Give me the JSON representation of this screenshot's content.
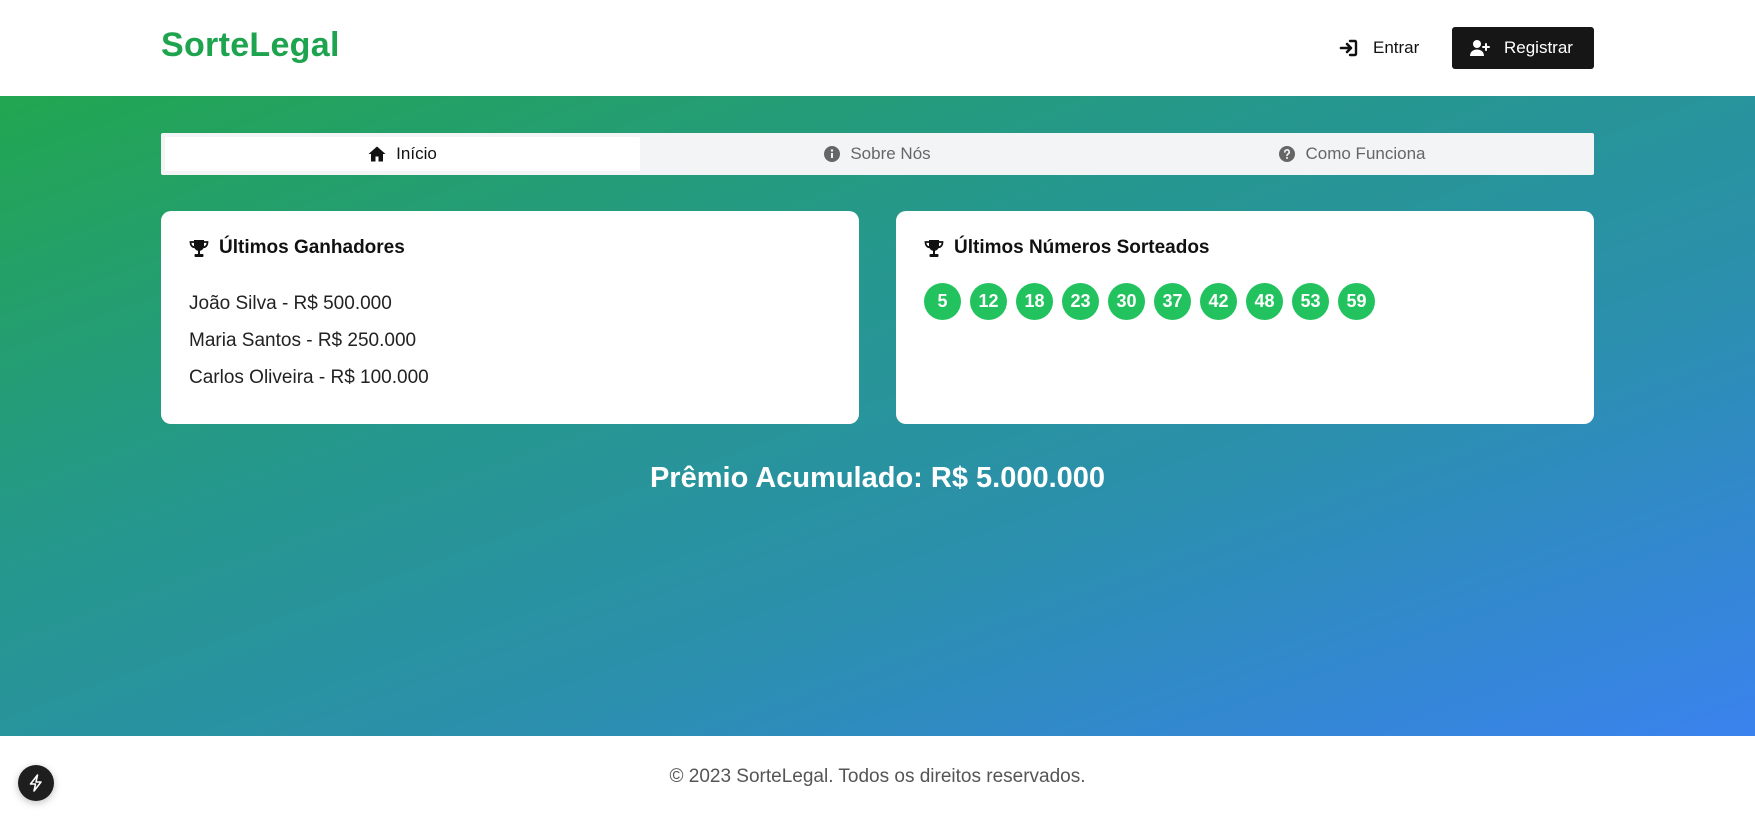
{
  "header": {
    "logo": "SorteLegal",
    "login_label": "Entrar",
    "register_label": "Registrar"
  },
  "tabs": [
    {
      "label": "Início",
      "icon": "home-icon",
      "active": true
    },
    {
      "label": "Sobre Nós",
      "icon": "info-icon",
      "active": false
    },
    {
      "label": "Como Funciona",
      "icon": "question-icon",
      "active": false
    }
  ],
  "winners_card": {
    "title": "Últimos Ganhadores",
    "icon": "trophy-icon",
    "items": [
      "João Silva - R$ 500.000",
      "Maria Santos - R$ 250.000",
      "Carlos Oliveira - R$ 100.000"
    ]
  },
  "numbers_card": {
    "title": "Últimos Números Sorteados",
    "icon": "trophy-icon",
    "numbers": [
      "5",
      "12",
      "18",
      "23",
      "30",
      "37",
      "42",
      "48",
      "53",
      "59"
    ]
  },
  "prize": "Prêmio Acumulado: R$ 5.000.000",
  "footer": {
    "text": "© 2023 SorteLegal. Todos os direitos reservados."
  },
  "colors": {
    "brand_green": "#1ea34e",
    "ball_green": "#22c35e",
    "gradient_start": "#22a650",
    "gradient_end": "#3a82ee",
    "dark_button": "#161616"
  }
}
